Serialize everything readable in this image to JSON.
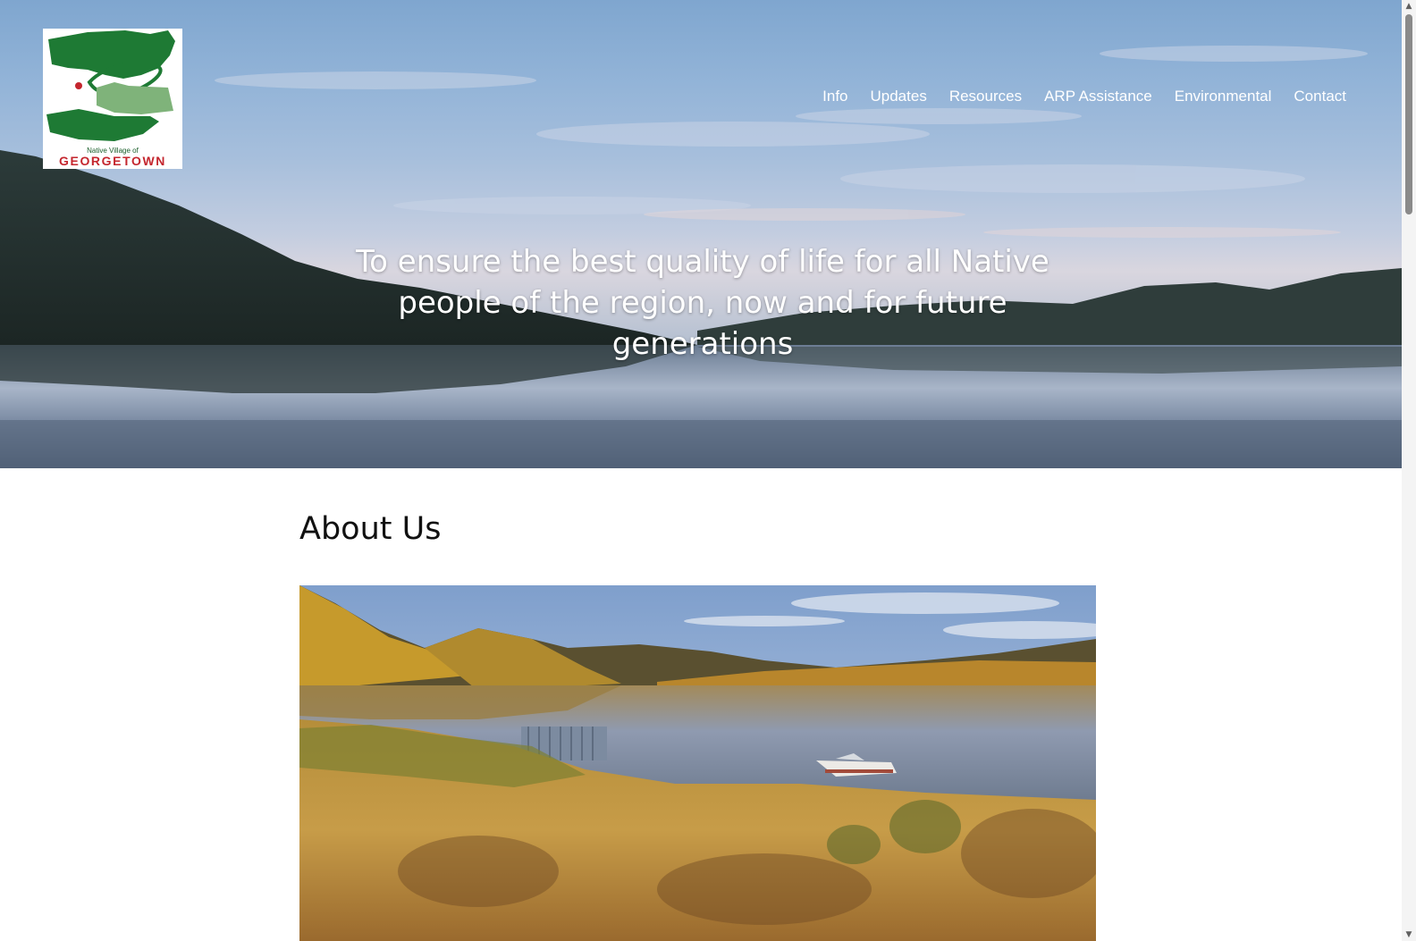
{
  "logo": {
    "small_text": "Native Village of",
    "big_text": "GEORGETOWN"
  },
  "nav": {
    "items": [
      {
        "label": "Info"
      },
      {
        "label": "Updates"
      },
      {
        "label": "Resources"
      },
      {
        "label": "ARP Assistance"
      },
      {
        "label": "Environmental"
      },
      {
        "label": "Contact"
      }
    ]
  },
  "hero": {
    "tagline": "To ensure the best quality of life for all Native people of the region, now and for future generations"
  },
  "about": {
    "title": "About Us"
  },
  "colors": {
    "logo_green": "#1e7a34",
    "logo_red": "#c4262e",
    "nav_text": "#ffffff"
  }
}
